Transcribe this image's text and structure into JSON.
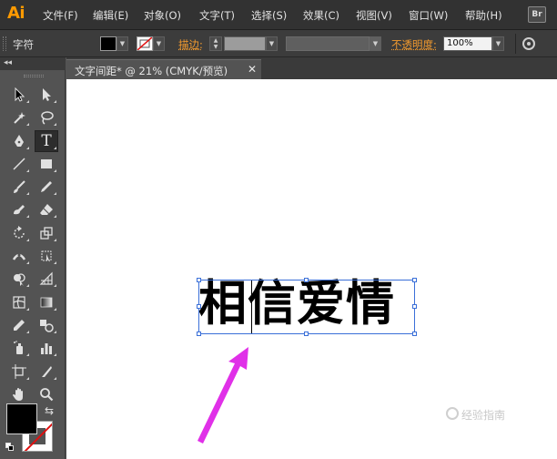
{
  "app": {
    "logo": "Ai",
    "menu": [
      "文件(F)",
      "编辑(E)",
      "对象(O)",
      "文字(T)",
      "选择(S)",
      "效果(C)",
      "视图(V)",
      "窗口(W)",
      "帮助(H)"
    ],
    "bridge_button": "Br"
  },
  "control_bar": {
    "label": "字符",
    "stroke_label": "描边:",
    "opacity_label": "不透明度:",
    "opacity_value": "100%",
    "fill_color": "#000000",
    "stroke_color": "none"
  },
  "document": {
    "tab_title": "文字间距* @ 21% (CMYK/预览)",
    "close": "✕"
  },
  "tools": {
    "selection": "selection-arrow-icon",
    "direct_selection": "direct-selection-icon",
    "magic_wand": "magic-wand-icon",
    "lasso": "lasso-icon",
    "pen": "pen-icon",
    "type": "T",
    "line": "line-segment-icon",
    "rectangle": "rectangle-icon",
    "paintbrush": "paintbrush-icon",
    "pencil": "pencil-icon",
    "blob_brush": "blob-brush-icon",
    "eraser": "eraser-icon",
    "rotate": "rotate-icon",
    "scale": "scale-icon",
    "width": "width-icon",
    "free_transform": "free-transform-icon",
    "shape_builder": "shape-builder-icon",
    "perspective_grid": "perspective-grid-icon",
    "mesh": "mesh-icon",
    "gradient": "gradient-icon",
    "eyedropper": "eyedropper-icon",
    "blend": "blend-icon",
    "symbol_sprayer": "symbol-sprayer-icon",
    "column_graph": "column-graph-icon",
    "artboard": "artboard-icon",
    "slice": "slice-icon",
    "hand": "hand-icon",
    "zoom": "zoom-icon"
  },
  "swatches": {
    "fill": "#000000",
    "stroke": "none"
  },
  "canvas": {
    "text": "相信爱情",
    "watermark": "经验指南"
  },
  "colors": {
    "menubar": "#323232",
    "panel": "#535353",
    "accent_label": "#f29a2e",
    "selection": "#3a6fd8",
    "annotation_arrow": "#e030e8"
  }
}
